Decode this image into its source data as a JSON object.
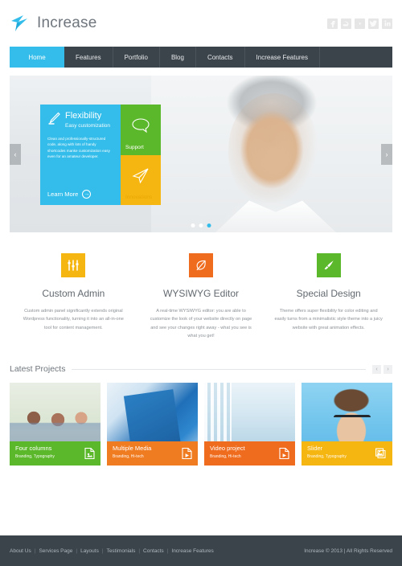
{
  "header": {
    "logo_text": "Increase",
    "logo_icon": "bird-logo-icon",
    "social": [
      {
        "name": "facebook-icon",
        "glyph": "f"
      },
      {
        "name": "behance-icon",
        "glyph": "a"
      },
      {
        "name": "vimeo-icon",
        "glyph": "v"
      },
      {
        "name": "twitter-icon",
        "glyph": "t"
      },
      {
        "name": "linkedin-icon",
        "glyph": "in"
      }
    ]
  },
  "nav": {
    "items": [
      {
        "label": "Home",
        "active": true
      },
      {
        "label": "Features",
        "active": false
      },
      {
        "label": "Portfolio",
        "active": false
      },
      {
        "label": "Blog",
        "active": false
      },
      {
        "label": "Contacts",
        "active": false
      },
      {
        "label": "Increase Features",
        "active": false
      }
    ],
    "active_color": "#34bdea",
    "bar_color": "#3b444b"
  },
  "hero": {
    "prev_label": "‹",
    "next_label": "›",
    "dots": 3,
    "active_dot": 3,
    "tile_main": {
      "title": "Flexibility",
      "subtitle": "Easy customization",
      "body": "Clean and professionally-structured code, along with lots of handy shortcodes manke customization easy even for an amateur developer.",
      "cta": "Learn More",
      "cta_icon": "arrow-right-circle-icon",
      "icon": "pen-icon",
      "color": "#34bdea"
    },
    "tile_support": {
      "label": "Support",
      "icon": "speech-bubble-icon",
      "color": "#5cb82b"
    },
    "tile_innovations": {
      "label": "Innovations",
      "icon": "paper-plane-icon",
      "color": "#f6b612"
    }
  },
  "features": [
    {
      "title": "Custom Admin",
      "text": "Custom admin panel significantly extends original Wordpress functionality, turning it into an all-in-one tool for content management.",
      "icon": "sliders-icon",
      "color": "#f6b612"
    },
    {
      "title": "WYSIWYG Editor",
      "text": "A real-time WYSIWYG editor: you are able to customize the look of your website directly on page and see your changes right away - what you see is what you get!",
      "icon": "leaf-icon",
      "color": "#ef6c1e"
    },
    {
      "title": "Special Design",
      "text": "Theme offers super flexibility for color editing and easily turns from a minimalistic style theme into a juicy website with great animation effects.",
      "icon": "brush-icon",
      "color": "#5cb82b"
    }
  ],
  "latest_projects": {
    "title": "Latest Projects",
    "prev_label": "‹",
    "next_label": "›",
    "items": [
      {
        "name": "Four columns",
        "tags": "Branding, Typography",
        "icon": "document-image-icon",
        "color": "#5cb82b"
      },
      {
        "name": "Multiple Media",
        "tags": "Branding, Hi-tech",
        "icon": "document-video-icon",
        "color": "#f07c22"
      },
      {
        "name": "Video project",
        "tags": "Branding, Hi-tech",
        "icon": "document-video-icon",
        "color": "#ef6c1e"
      },
      {
        "name": "Slider",
        "tags": "Branding, Typography",
        "icon": "gallery-stack-icon",
        "color": "#f6b612"
      }
    ]
  },
  "footer": {
    "links": [
      "About Us",
      "Services Page",
      "Layouts",
      "Testimonials",
      "Contacts",
      "Increase Features"
    ],
    "separator": "|",
    "copyright": "Increase © 2013 | All Rights Reserved"
  }
}
